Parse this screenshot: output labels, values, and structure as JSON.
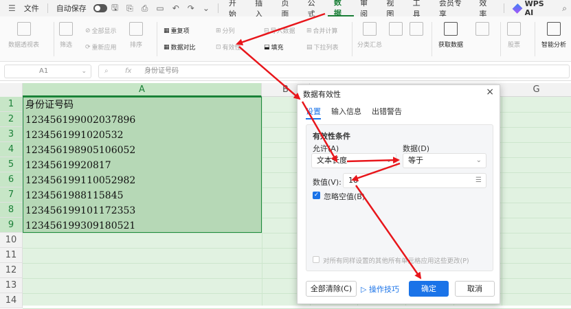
{
  "menubar": {
    "file": "文件",
    "autosave": "自动保存",
    "tabs": [
      "开始",
      "插入",
      "页面",
      "公式",
      "数据",
      "审阅",
      "视图",
      "工具",
      "会员专享",
      "效率"
    ],
    "active_tab": "数据",
    "ai": "WPS AI"
  },
  "ribbon": {
    "pivot": "数据透视表",
    "filter": "筛选",
    "show_all": "全部显示",
    "reapply": "重新应用",
    "sort": "排序",
    "duplicates": "重复项",
    "compare": "数据对比",
    "split": "分列",
    "validity": "有效性",
    "import_data": "导入数据",
    "fill": "填充",
    "merge_calc": "合并计算",
    "dropdown": "下拉列表",
    "subtotal": "分类汇总",
    "get_data": "获取数据",
    "stocks": "股票",
    "smart": "智能分析"
  },
  "formula": {
    "cell": "A1",
    "fx": "fx",
    "value": "身份证号码"
  },
  "sheet": {
    "columns": [
      "A",
      "B",
      "G"
    ],
    "rows": [
      "1",
      "2",
      "3",
      "4",
      "5",
      "6",
      "7",
      "8",
      "9",
      "10",
      "11",
      "12",
      "13",
      "14"
    ],
    "cells": [
      "身份证号码",
      "123456199002037896",
      "1234561991020532",
      "123456198905106052",
      "12345619920817",
      "123456199110052982",
      "1234561988115845",
      "123456199101172353",
      "123456199309180521"
    ]
  },
  "dialog": {
    "title": "数据有效性",
    "tabs": [
      "设置",
      "输入信息",
      "出错警告"
    ],
    "section": "有效性条件",
    "allow_label": "允许(A)",
    "allow_value": "文本长度",
    "data_label": "数据(D)",
    "data_value": "等于",
    "value_label": "数值(V):",
    "value_value": "18",
    "ignore_blank": "忽略空值(B)",
    "apply_all": "对所有同样设置的其他所有单元格应用这些更改(P)",
    "clear_all": "全部清除(C)",
    "tips": "操作技巧",
    "ok": "确定",
    "cancel": "取消"
  },
  "colors": {
    "accent": "#1a73e8",
    "green": "#1a7f37",
    "arrow": "#e8161b"
  }
}
